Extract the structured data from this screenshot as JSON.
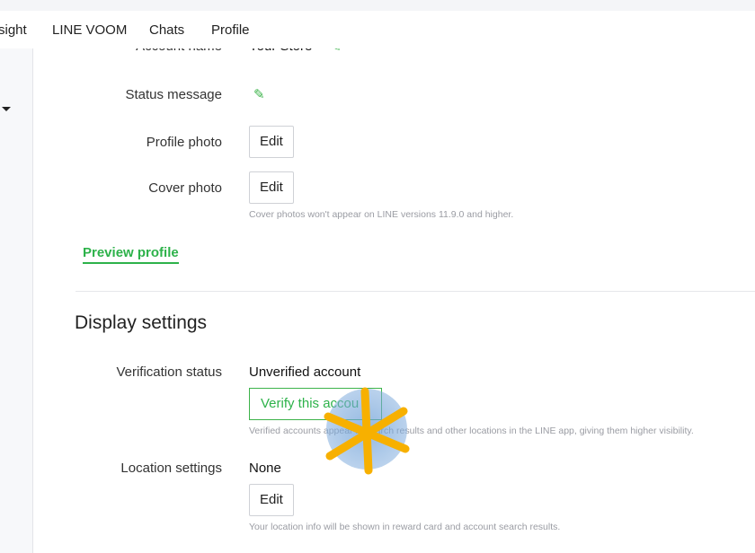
{
  "nav": {
    "items": [
      "sight",
      "LINE VOOM",
      "Chats",
      "Profile"
    ]
  },
  "profile": {
    "account_name_label": "Account name",
    "account_name_value": "Your Store",
    "status_message_label": "Status message",
    "profile_photo_label": "Profile photo",
    "profile_photo_button": "Edit",
    "cover_photo_label": "Cover photo",
    "cover_photo_button": "Edit",
    "cover_photo_hint": "Cover photos won't appear on LINE versions 11.9.0 and higher.",
    "preview_link": "Preview profile"
  },
  "display_settings": {
    "title": "Display settings",
    "verification_label": "Verification status",
    "verification_value": "Unverified account",
    "verify_button": "Verify this accou",
    "verification_hint": "Verified accounts appear in search results and other locations in the LINE app, giving them higher visibility.",
    "location_label": "Location settings",
    "location_value": "None",
    "location_button": "Edit",
    "location_hint": "Your location info will be shown in reward card and account search results."
  },
  "colors": {
    "accent": "#2db24a",
    "cursor_highlight": "#6ea0d7",
    "click_marker": "#f7b000"
  }
}
